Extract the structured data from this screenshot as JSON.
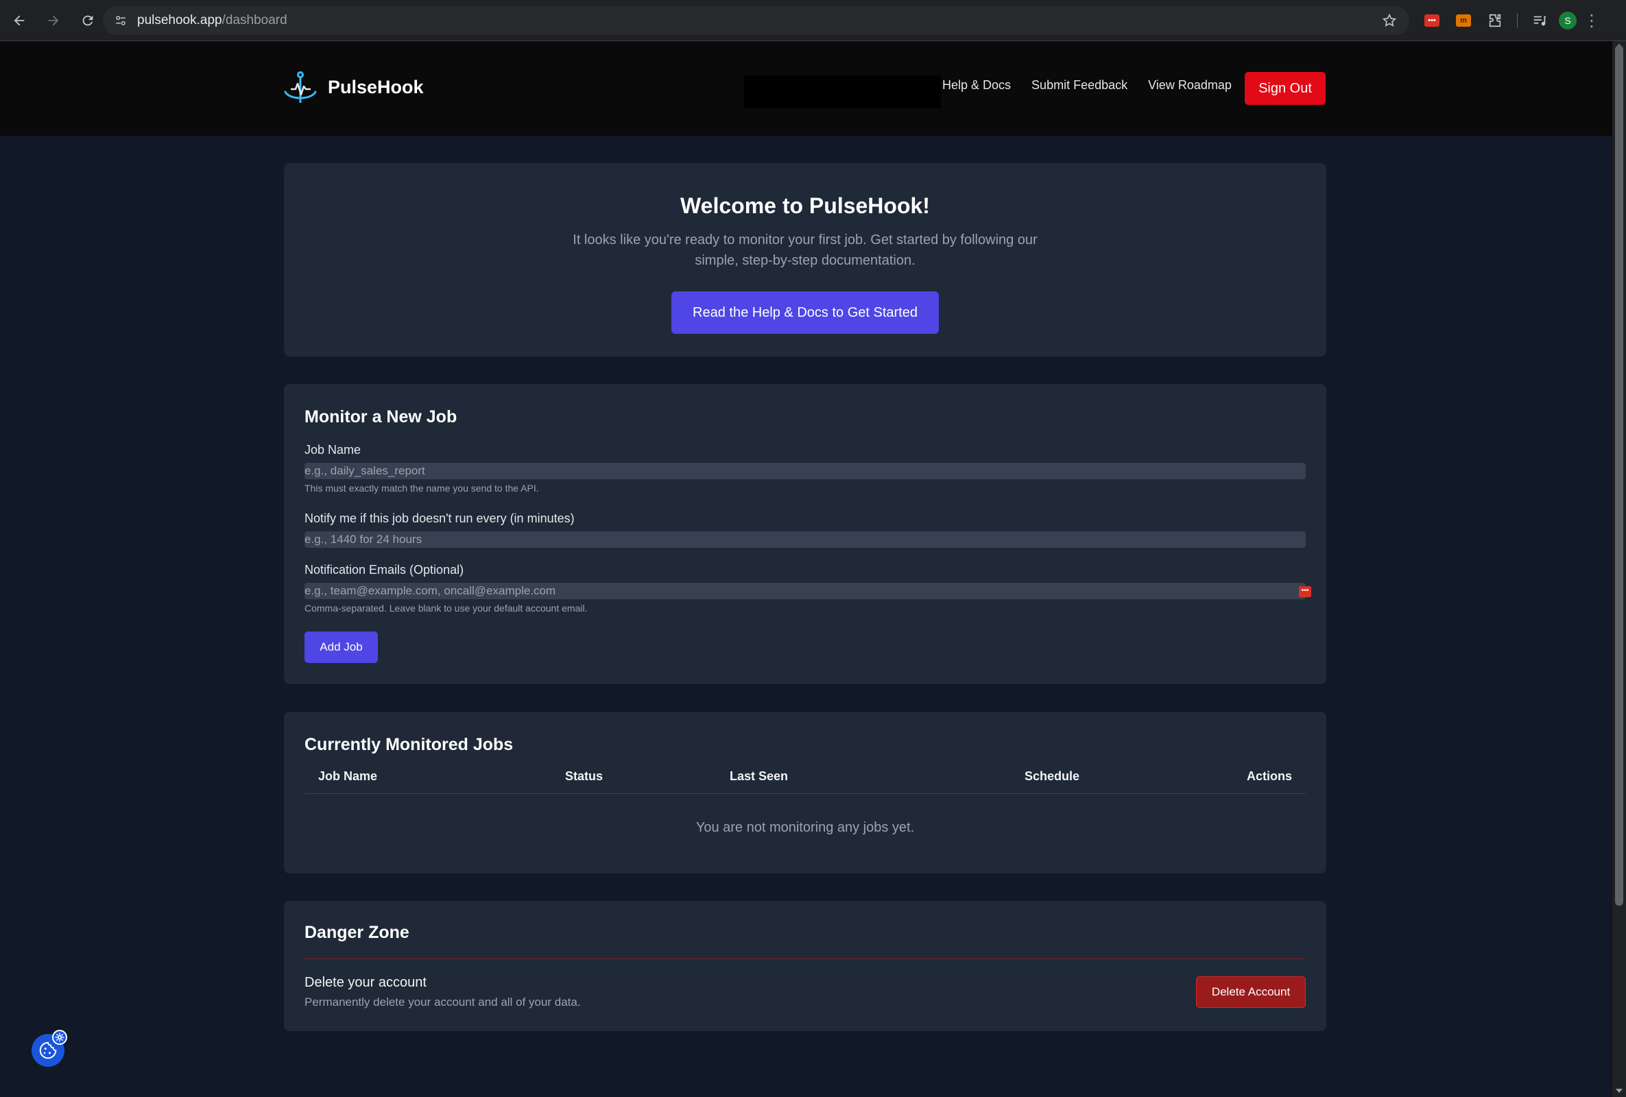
{
  "browser": {
    "url_host": "pulsehook.app",
    "url_path": "/dashboard",
    "profile_initial": "S",
    "extension_labels": [
      "•••",
      "m"
    ]
  },
  "header": {
    "brand": "PulseHook",
    "nav": [
      "Help & Docs",
      "Submit Feedback",
      "View Roadmap"
    ],
    "signout_label": "Sign Out"
  },
  "welcome": {
    "title": "Welcome to PulseHook!",
    "text": "It looks like you're ready to monitor your first job. Get started by following our simple, step-by-step documentation.",
    "cta": "Read the Help & Docs to Get Started"
  },
  "monitor": {
    "title": "Monitor a New Job",
    "job_name_label": "Job Name",
    "job_name_placeholder": "e.g., daily_sales_report",
    "job_name_hint": "This must exactly match the name you send to the API.",
    "interval_label": "Notify me if this job doesn't run every (in minutes)",
    "interval_placeholder": "e.g., 1440 for 24 hours",
    "emails_label": "Notification Emails (Optional)",
    "emails_placeholder": "e.g., team@example.com, oncall@example.com",
    "emails_hint": "Comma-separated. Leave blank to use your default account email.",
    "add_button": "Add Job",
    "pw_icon_text": "•••"
  },
  "jobs": {
    "title": "Currently Monitored Jobs",
    "columns": [
      "Job Name",
      "Status",
      "Last Seen",
      "Schedule",
      "Actions"
    ],
    "empty_text": "You are not monitoring any jobs yet."
  },
  "danger": {
    "title": "Danger Zone",
    "delete_title": "Delete your account",
    "delete_desc": "Permanently delete your account and all of your data.",
    "delete_button": "Delete Account"
  },
  "colors": {
    "accent": "#4f46e5",
    "danger": "#e20a16",
    "card": "#1f2937",
    "page": "#111827"
  }
}
